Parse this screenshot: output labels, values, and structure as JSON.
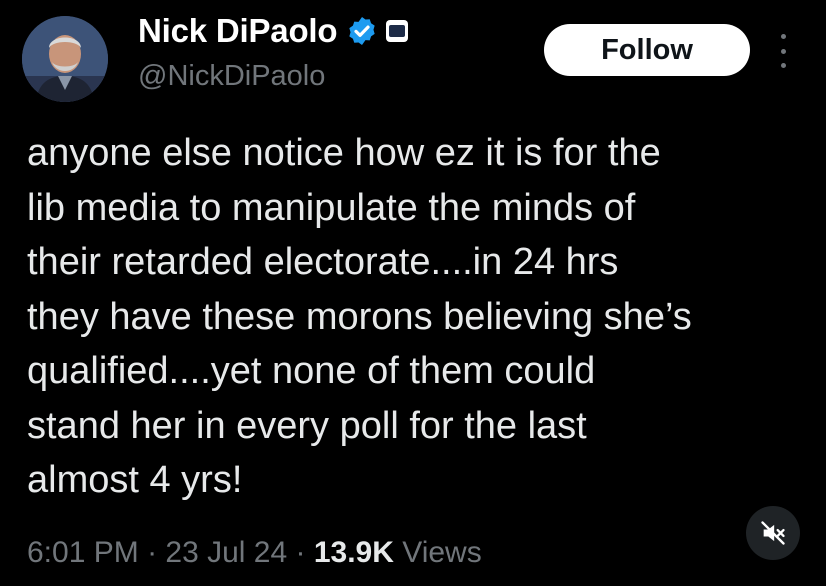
{
  "author": {
    "name": "Nick DiPaolo",
    "handle": "@NickDiPaolo",
    "verified": true
  },
  "actions": {
    "follow_label": "Follow"
  },
  "tweet": {
    "text": "anyone else notice how ez it is for the\nlib media to manipulate the minds of\ntheir retarded electorate....in 24 hrs\nthey have these morons believing she’s\nqualified....yet none of them could\nstand her in every poll for the last\nalmost 4 yrs!"
  },
  "meta": {
    "time": "6:01 PM",
    "sep1": " · ",
    "date": "23 Jul 24",
    "sep2": " · ",
    "views_count": "13.9K",
    "views_label": " Views"
  },
  "icons": {
    "verified": "verified-badge-icon",
    "affiliation": "affiliation-badge-icon",
    "more": "more-options-icon",
    "mute": "muted-speaker-icon"
  },
  "colors": {
    "background": "#000000",
    "text": "#e7e9ea",
    "secondary": "#71767b",
    "verified_blue": "#1d9bf0",
    "follow_bg": "#ffffff"
  }
}
